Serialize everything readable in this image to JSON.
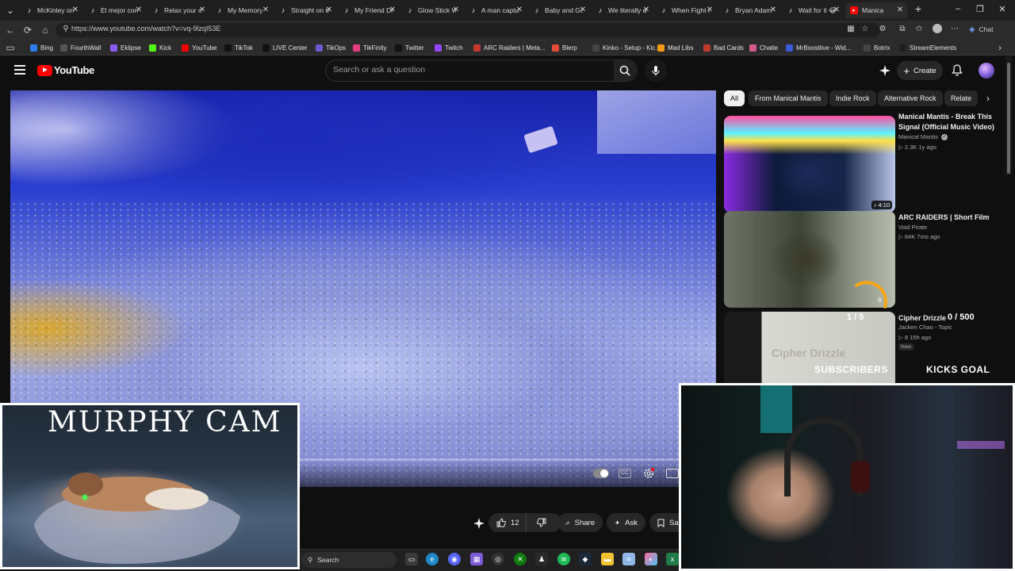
{
  "browser": {
    "tabs": [
      {
        "title": "McKinley on",
        "icon": "tiktok-icon"
      },
      {
        "title": "El mejor con",
        "icon": "tiktok-icon"
      },
      {
        "title": "Relax your ch",
        "icon": "tiktok-icon"
      },
      {
        "title": "My Memory",
        "icon": "tiktok-icon"
      },
      {
        "title": "Straight on th",
        "icon": "tiktok-icon"
      },
      {
        "title": "My Friend Dr",
        "icon": "tiktok-icon"
      },
      {
        "title": "Glow Stick W",
        "icon": "tiktok-icon"
      },
      {
        "title": "A man captu",
        "icon": "tiktok-icon"
      },
      {
        "title": "Baby and Go",
        "icon": "tiktok-icon"
      },
      {
        "title": "We literally d",
        "icon": "tiktok-icon"
      },
      {
        "title": "When Fight o",
        "icon": "tiktok-icon"
      },
      {
        "title": "Bryan Adam",
        "icon": "tiktok-icon"
      },
      {
        "title": "Wait for it 😂",
        "icon": "tiktok-icon"
      },
      {
        "title": "Manica",
        "icon": "youtube-icon"
      }
    ],
    "url": "https://www.youtube.com/watch?v=vq-9lzqI53E",
    "chat_label": "Chat",
    "bookmarks": [
      {
        "label": "Bing",
        "color": "#2b7de9"
      },
      {
        "label": "FourthWall",
        "color": "#555555"
      },
      {
        "label": "Eklipse",
        "color": "#8b5cf6"
      },
      {
        "label": "Kick",
        "color": "#53fc18"
      },
      {
        "label": "YouTube",
        "color": "#ff0000"
      },
      {
        "label": "TikTok",
        "color": "#111111"
      },
      {
        "label": "LIVE Center",
        "color": "#111111"
      },
      {
        "label": "TikOps",
        "color": "#6a5acd"
      },
      {
        "label": "TikFinity",
        "color": "#e23d7b"
      },
      {
        "label": "Twitter",
        "color": "#111111"
      },
      {
        "label": "Twitch",
        "color": "#9146ff"
      },
      {
        "label": "ARC Raiders | Meta...",
        "color": "#c0392b"
      },
      {
        "label": "Blerp",
        "color": "#e74c3c"
      },
      {
        "label": "Kinko - Setup - Kic...",
        "color": "#444444"
      },
      {
        "label": "Mad Libs",
        "color": "#f39c12"
      },
      {
        "label": "Bad Cards",
        "color": "#c0392b"
      },
      {
        "label": "Chatle",
        "color": "#d35a8c"
      },
      {
        "label": "MrBoostlive - Wid...",
        "color": "#3b5bdb"
      },
      {
        "label": "Botrix",
        "color": "#444444"
      },
      {
        "label": "StreamElements",
        "color": "#1f1f1f"
      }
    ]
  },
  "youtube": {
    "logo_text": "YouTube",
    "search_placeholder": "Search or ask a question",
    "create_label": "Create",
    "chips": [
      "All",
      "From Manical Mantis",
      "Indie Rock",
      "Alternative Rock",
      "Relate"
    ],
    "recommendations": [
      {
        "title": "Manical Mantis - Break This Signal (Official Music Video)",
        "channel": "Manical Mantis",
        "verified": true,
        "meta": "▷ 2.3K  1y ago",
        "duration": "♪ 4:10"
      },
      {
        "title": "ARC RAIDERS | Short Film",
        "channel": "Void Pirate",
        "verified": false,
        "meta": "▷ 84K  7mo ago",
        "duration": ""
      },
      {
        "title": "Cipher Drizzle",
        "channel": "Jacken Chao - Topic",
        "verified": false,
        "meta": "▷ 8  15h ago",
        "badge": "New",
        "thumb_text": "Cipher Drizzle"
      }
    ],
    "actions": {
      "likes": "12",
      "share_label": "Share",
      "ask_label": "Ask",
      "save_label": "Sa"
    },
    "player": {
      "cc_label": "CC"
    }
  },
  "overlay": {
    "subscribers_goal": "1 / 5",
    "subscribers_label": "SUBSCRIBERS",
    "kicks_goal": "0 / 500",
    "kicks_label": "KICKS GOAL",
    "murphy_cam_title": "MURPHY CAM",
    "arc_value": "6"
  },
  "taskbar": {
    "search_label": "Search"
  }
}
